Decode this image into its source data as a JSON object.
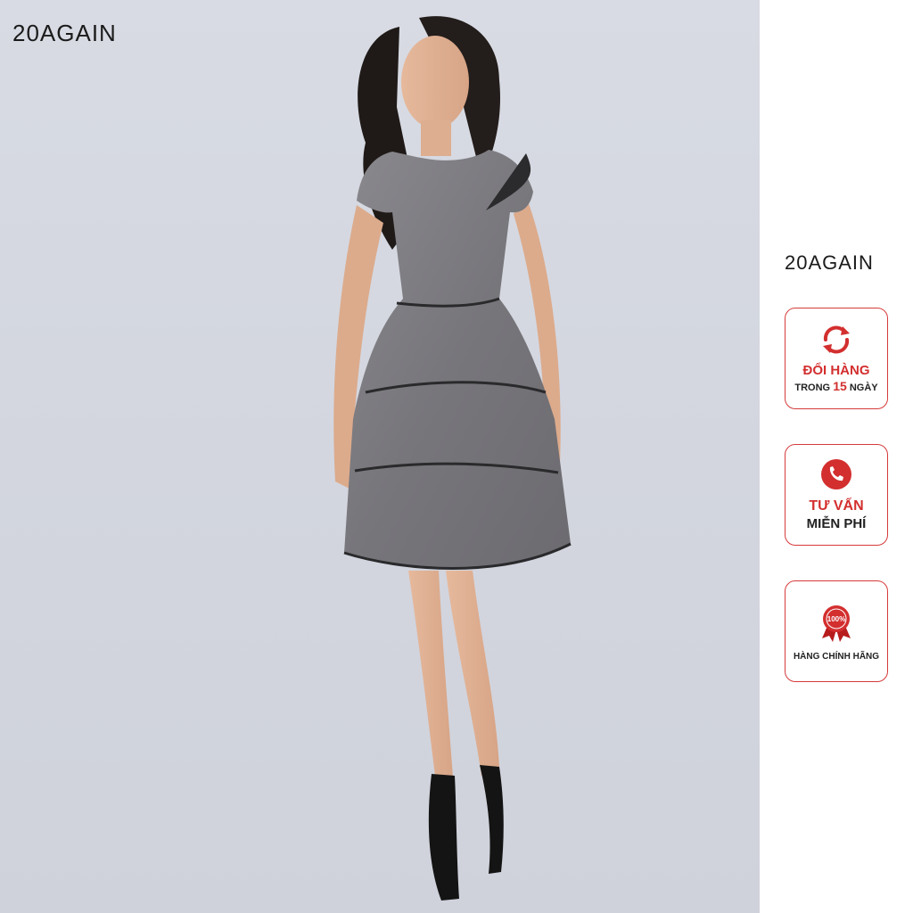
{
  "brand": {
    "logo_text": "20AGAIN"
  },
  "badges": {
    "exchange": {
      "title": "ĐỔI HÀNG",
      "sub_prefix": "TRONG",
      "days": "15",
      "sub_suffix": "NGÀY",
      "icon": "refresh-icon"
    },
    "consult": {
      "line1": "TƯ VẤN",
      "line2": "MIỄN PHÍ",
      "icon": "phone-icon"
    },
    "authentic": {
      "label": "HÀNG CHÍNH HÃNG",
      "seal_text": "100%",
      "icon": "ribbon-seal-icon"
    }
  },
  "colors": {
    "accent": "#d32f2f",
    "background": "#d5d8e0",
    "dress": "#7c7b80"
  }
}
